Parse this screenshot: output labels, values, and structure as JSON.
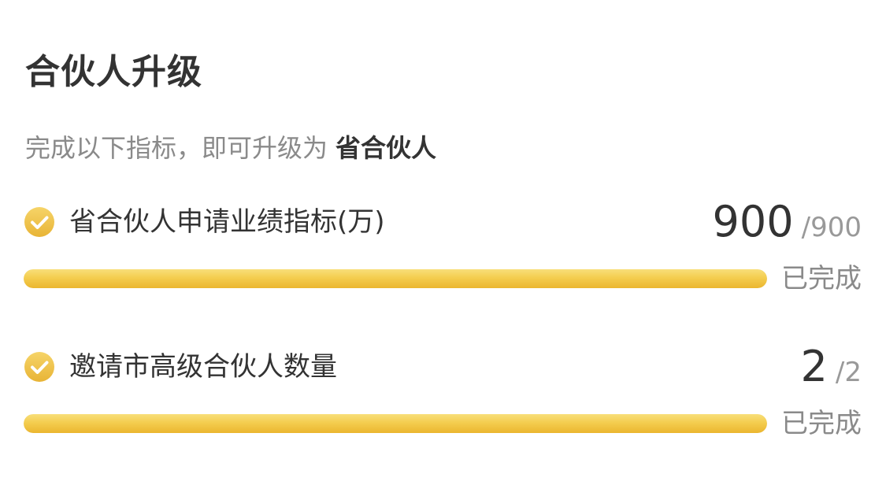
{
  "header": {
    "title": "合伙人升级"
  },
  "subtitle": {
    "text": "完成以下指标，即可升级为",
    "target_level": "省合伙人"
  },
  "colors": {
    "accent_gold": "#f4cd4f",
    "check_gold": "#f1c248",
    "text_primary": "#333333",
    "text_secondary": "#8a8a8a"
  },
  "requirements": [
    {
      "icon": "check-circle-icon",
      "label": "省合伙人申请业绩指标(万)",
      "current": "900",
      "separator": "/",
      "total": "900",
      "progress": 1.0,
      "status": "已完成"
    },
    {
      "icon": "check-circle-icon",
      "label": "邀请市高级合伙人数量",
      "current": "2",
      "separator": "/",
      "total": "2",
      "progress": 1.0,
      "status": "已完成"
    }
  ]
}
